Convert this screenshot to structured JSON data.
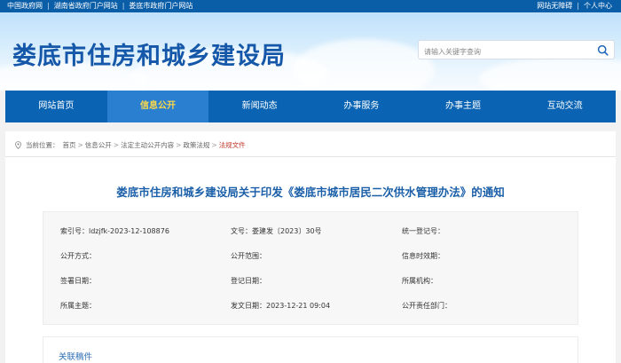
{
  "topbar": {
    "links": [
      "中国政府网",
      "湖南省政府门户网站",
      "娄底市政府门户网站"
    ],
    "accessibility": "网站无障碍",
    "personal_center": "个人中心"
  },
  "header": {
    "site_title": "娄底市住房和城乡建设局",
    "search_placeholder": "请输入关键字查询"
  },
  "nav": {
    "items": [
      "网站首页",
      "信息公开",
      "新闻动态",
      "办事服务",
      "办事主题",
      "互动交流"
    ],
    "active_index": 1
  },
  "breadcrumb": {
    "prefix": "当前位置：",
    "items": [
      "首页",
      "信息公开",
      "法定主动公开内容",
      "政策法规",
      "法规文件"
    ]
  },
  "article": {
    "title": "娄底市住房和城乡建设局关于印发《娄底市城市居民二次供水管理办法》的通知"
  },
  "meta": {
    "rows": [
      [
        "索引号：ldzjfk-2023-12-108876",
        "文号：娄建发〔2023〕30号",
        "统一登记号："
      ],
      [
        "公开方式：",
        "公开范围：",
        "信息时效期："
      ],
      [
        "签署日期：",
        "登记日期：",
        "所属机构："
      ],
      [
        "所属主题：",
        "发文日期：2023-12-21 09:04",
        "公开责任部门："
      ]
    ]
  },
  "related": {
    "label": "关联稿件"
  },
  "colors": {
    "nav_blue": "#0a64b3",
    "active_tab": "#2a7fd0",
    "active_text": "#ffd949",
    "title_blue": "#1557a8"
  }
}
